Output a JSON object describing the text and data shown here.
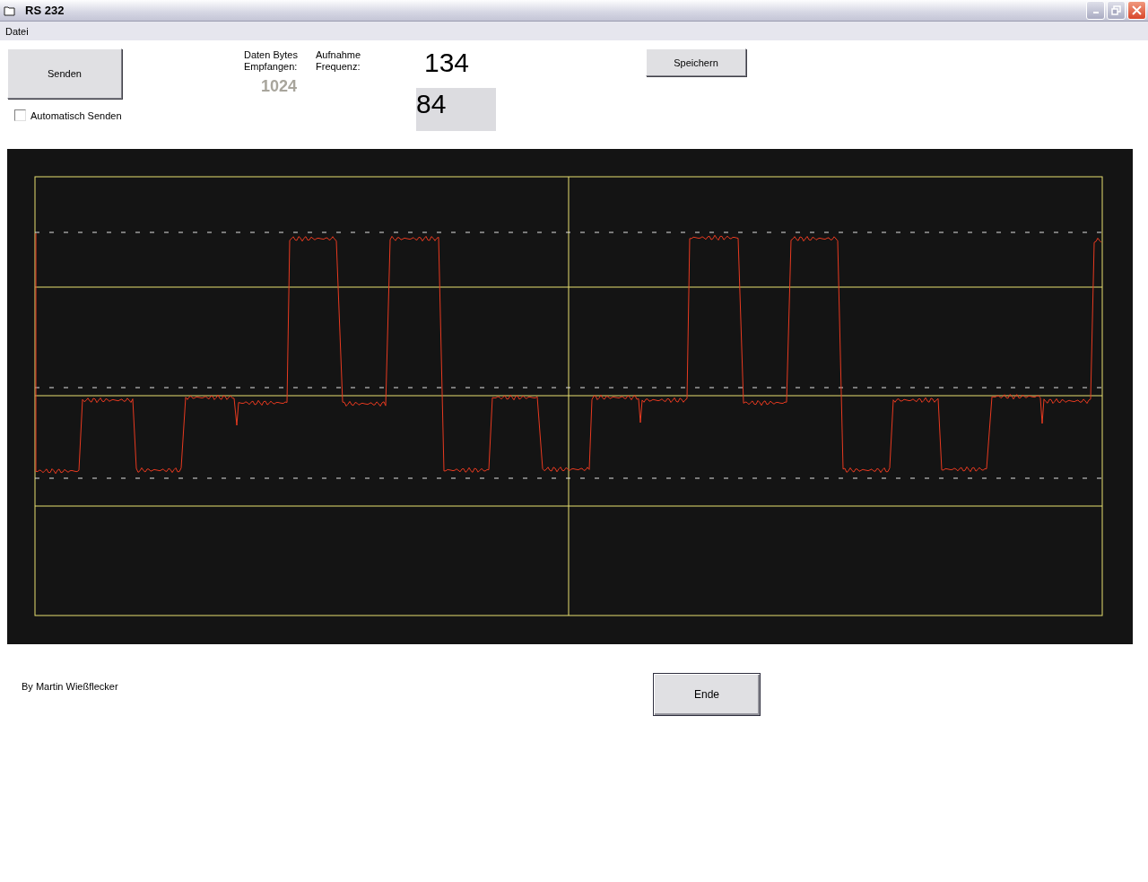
{
  "window": {
    "title": "RS 232"
  },
  "menu": [
    "Datei"
  ],
  "send_button": {
    "label": "Senden"
  },
  "auto_send": {
    "label": "Automatisch Senden",
    "checked": false
  },
  "bytes_received": {
    "label": "Daten Bytes\nEmpfangen:",
    "value": "1024"
  },
  "sample_rate": {
    "label": "Aufnahme\nFrequenz:",
    "value": "134",
    "input": "84"
  },
  "save_button": {
    "label": "Speichern"
  },
  "author": "By Martin Wießflecker",
  "end_button": {
    "label": "Ende"
  }
}
